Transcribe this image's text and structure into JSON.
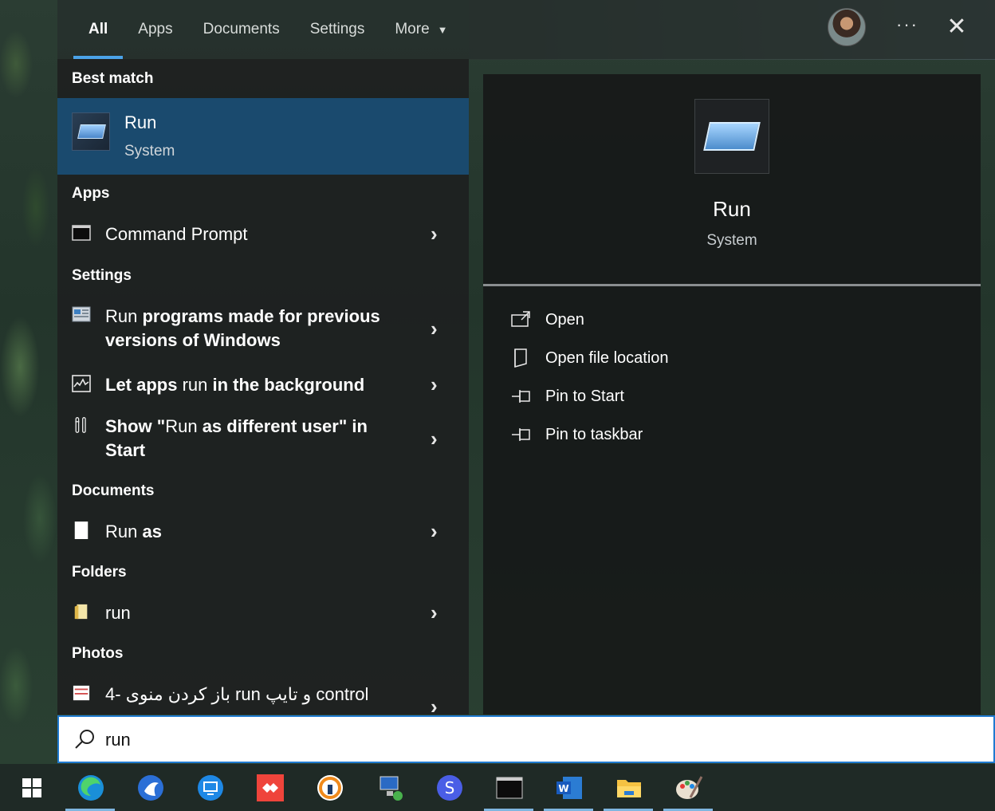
{
  "tabs": [
    {
      "label": "All",
      "active": true
    },
    {
      "label": "Apps"
    },
    {
      "label": "Documents"
    },
    {
      "label": "Settings"
    },
    {
      "label": "More"
    }
  ],
  "header": {
    "more_options_icon": "ellipsis-icon",
    "close_icon": "close-icon"
  },
  "best_match": {
    "title": "Best match",
    "name": "Run",
    "type": "System"
  },
  "groups": {
    "apps": "Apps",
    "settings": "Settings",
    "documents": "Documents",
    "folders": "Folders",
    "photos": "Photos"
  },
  "results": {
    "apps": [
      {
        "label": "Command Prompt",
        "icon": "command-prompt-icon"
      }
    ],
    "settings": [
      {
        "match": "Run",
        "rest": " programs made for previous versions of Windows",
        "icon": "compatibility-icon"
      },
      {
        "pre": "Let apps ",
        "match": "run",
        "post": " in the background",
        "icon": "background-apps-icon"
      },
      {
        "pre": "Show \"",
        "match": "Run",
        "post": " as different user\" in Start",
        "icon": "tools-icon"
      }
    ],
    "documents": [
      {
        "match": "Run",
        "rest": " as",
        "icon": "document-icon"
      }
    ],
    "folders": [
      {
        "label": "run",
        "icon": "folder-icon"
      }
    ],
    "photos": [
      {
        "label": "4- باز کردن منوی run و تایپ control",
        "icon": "photo-icon"
      }
    ]
  },
  "preview": {
    "title": "Run",
    "subtitle": "System",
    "actions": [
      {
        "label": "Open",
        "icon": "open-icon"
      },
      {
        "label": "Open file location",
        "icon": "file-location-icon"
      },
      {
        "label": "Pin to Start",
        "icon": "pin-icon"
      },
      {
        "label": "Pin to taskbar",
        "icon": "pin-icon"
      }
    ]
  },
  "search": {
    "value": "run"
  },
  "taskbar": {
    "items": [
      "start-icon",
      "edge-icon",
      "app-icon",
      "remote-desktop-icon",
      "anydesk-icon",
      "vpn-icon",
      "network-icon",
      "app-s-icon",
      "terminal-icon",
      "word-icon",
      "file-explorer-icon",
      "paint-icon"
    ]
  },
  "colors": {
    "accent": "#4ba3e8",
    "selection": "#1a4a6e",
    "search_border": "#1f7ad0"
  }
}
